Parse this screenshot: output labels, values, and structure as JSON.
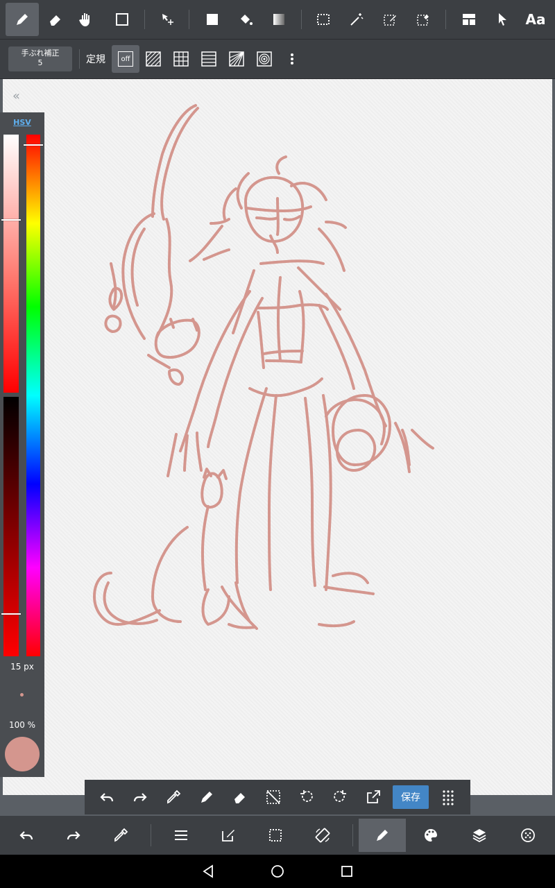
{
  "toolbar": {
    "tools": [
      "pen-icon",
      "eraser-icon",
      "hand-icon",
      "rectangle-icon",
      "move-icon",
      "fill-icon",
      "bucket-icon",
      "gradient-icon",
      "select-icon",
      "magic-wand-icon",
      "select-pen-icon",
      "select-eraser-icon",
      "frame-icon",
      "pointer-icon",
      "text-icon"
    ],
    "text_tool_label": "Aa"
  },
  "subbar": {
    "stabilizer_label": "手ぶれ補正",
    "stabilizer_value": "5",
    "ruler_label": "定規",
    "ruler_off": "off"
  },
  "color_panel": {
    "mode_label": "HSV",
    "brush_size": "15 px",
    "opacity": "100 %",
    "current_color": "#d4968e"
  },
  "quick_bar": {
    "save_label": "保存"
  },
  "colors": {
    "toolbar_bg": "#3c3f43",
    "accent": "#4386c6",
    "sketch": "#d4968e"
  }
}
